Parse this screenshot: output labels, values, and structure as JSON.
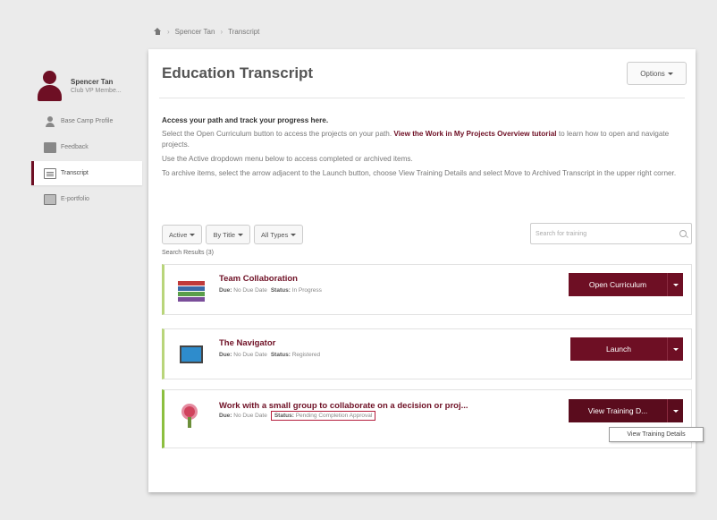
{
  "breadcrumb": {
    "items": [
      "Spencer Tan",
      "Transcript"
    ]
  },
  "profile": {
    "name": "Spencer Tan",
    "role": "Club VP Membe..."
  },
  "sidebar": {
    "items": [
      {
        "label": "Base Camp Profile",
        "icon": "person-icon"
      },
      {
        "label": "Feedback",
        "icon": "chat-icon"
      },
      {
        "label": "Transcript",
        "icon": "document-icon",
        "active": true
      },
      {
        "label": "E-portfolio",
        "icon": "portfolio-icon"
      }
    ]
  },
  "page": {
    "title": "Education Transcript",
    "options_label": "Options"
  },
  "intro": {
    "lead": "Access your path and track your progress here.",
    "line1_pre": "Select the Open Curriculum button to access the projects on your path.",
    "line1_link": "View the Work in My Projects Overview tutorial",
    "line1_post": "to learn how to open and navigate projects.",
    "line2": "Use the Active dropdown menu below to access completed or archived items.",
    "line3": "To archive items, select the arrow adjacent to the Launch button, choose View Training Details and select Move to Archived Transcript in the upper right corner."
  },
  "filters": {
    "active": "Active",
    "by_title": "By Title",
    "all_types": "All Types"
  },
  "search": {
    "placeholder": "Search for training"
  },
  "results_label": "Search Results (3)",
  "meta_labels": {
    "due": "Due:",
    "status": "Status:"
  },
  "items": [
    {
      "title": "Team Collaboration",
      "due": "No Due Date",
      "status": "In Progress",
      "button": "Open Curriculum"
    },
    {
      "title": "The Navigator",
      "due": "No Due Date",
      "status": "Registered",
      "button": "Launch"
    },
    {
      "title": "Work with a small group to collaborate on a decision or proj...",
      "due": "No Due Date",
      "status": "Pending Completion Approval",
      "button": "View Training D..."
    }
  ],
  "tooltip": "View Training Details",
  "colors": {
    "accent": "#6e0f24",
    "progress_bar": "#8cbf3f"
  }
}
